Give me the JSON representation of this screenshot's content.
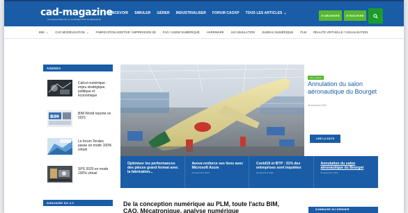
{
  "header": {
    "logo_text": "cad-magazine",
    "logo_tagline": "LE MAGAZINE DE LA CONCEPTION NUMERIQUE",
    "nav": [
      "CONCEVOIR",
      "SIMULER",
      "GÉRER",
      "INDUSTRIALISER",
      "FORUM CAOXP"
    ],
    "nav_articles": "TOUS LES ARTICLES",
    "subscribe_label": "S'ABONNER",
    "signin_label": "S'INSCRIRE"
  },
  "subnav": {
    "items": [
      {
        "label": "BIM",
        "dropdown": true
      },
      {
        "label": "CAO MODÉLISATION",
        "dropdown": true
      },
      {
        "label": "FABRICATION ADDITIVE / IMPRESSION 3D",
        "dropdown": false
      },
      {
        "label": "FAO / USINE NUMÉRIQUE",
        "dropdown": false
      },
      {
        "label": "HARDWARE",
        "dropdown": false
      },
      {
        "label": "IAO SIMULATION",
        "dropdown": false
      },
      {
        "label": "JUMEAU NUMÉRIQUE",
        "dropdown": false
      },
      {
        "label": "PLM",
        "dropdown": false
      },
      {
        "label": "RÉALITÉ VIRTUELLE / VISUALISATION",
        "dropdown": false
      }
    ]
  },
  "agenda": {
    "heading": "AGENDA",
    "items": [
      {
        "title": "Calcul numérique : enjeu stratégique, politique et économique"
      },
      {
        "title": "BIM World reporté en 2021"
      },
      {
        "title": "Le forum Teratec passe en mode 100% virtuel"
      },
      {
        "title": "SPS 2020 en mode 100% virtuel"
      }
    ]
  },
  "hero": {
    "badge": "Non classé",
    "title": "Annulation du salon aéronautique du Bourget",
    "date": "05 décembre 2020",
    "button_label": "LIRE LA SUITE"
  },
  "strip": [
    {
      "title": "Optimiser les performances des pièces grand format avec la fabrication...",
      "date": "",
      "underline": false
    },
    {
      "title": "Aveva renforce ses liens avec Microsoft Azure",
      "date": "04 décembre 2020",
      "underline": false
    },
    {
      "title": "Covid19 et BTP : 31% des entreprises sont inquiètes",
      "date": "04 décembre 2020",
      "underline": false
    },
    {
      "title": "Annulation du salon aéronautique du Bourget",
      "date": "05 décembre 2020",
      "underline": true
    }
  ],
  "bottom": {
    "annuaire_heading": "ANNUAIRE DU 4.0",
    "headline": "De la conception numérique au PLM, toute l'actu BIM, CAO, Mécatronique, analyse numérique",
    "right_heading": "SOMMAIRE DU DERNIER"
  },
  "colors": {
    "brand_blue": "#1a5da6",
    "green": "#57b82f",
    "search_green": "#1b9c2d"
  }
}
